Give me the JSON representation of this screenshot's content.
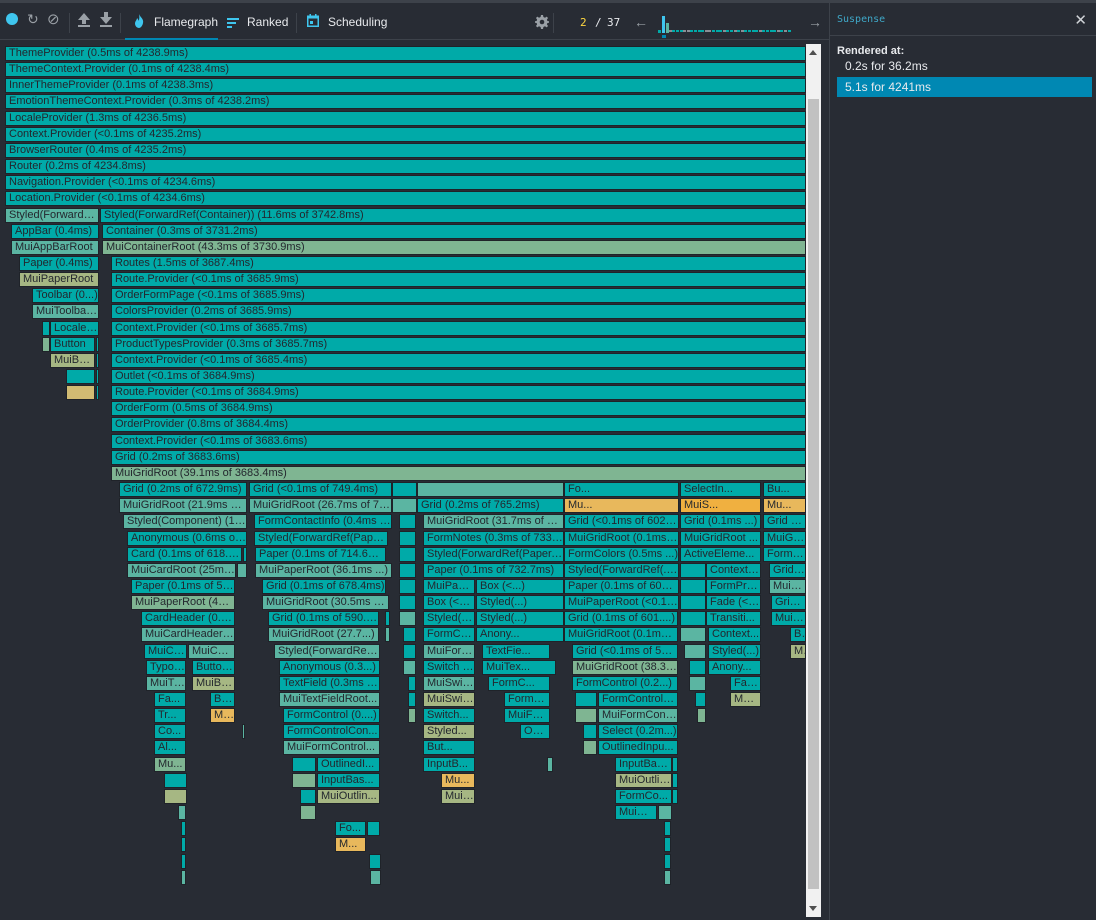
{
  "toolbar": {
    "buttons": [
      {
        "name": "record-button",
        "icon": "record-icon",
        "glyph": "●"
      },
      {
        "name": "reload-and-profile-button",
        "icon": "reload-icon",
        "glyph": "↻"
      },
      {
        "name": "clear-profile-button",
        "icon": "clear-icon",
        "glyph": "⊘"
      },
      {
        "name": "load-profile-button",
        "icon": "upload-icon",
        "glyph": "⇧"
      },
      {
        "name": "save-profile-button",
        "icon": "download-icon",
        "glyph": "⇩"
      }
    ],
    "tabs": [
      {
        "label": "Flamegraph",
        "icon": "flame-icon",
        "active": true
      },
      {
        "label": "Ranked",
        "icon": "ranked-icon",
        "active": false
      },
      {
        "label": "Scheduling",
        "icon": "calendar-icon",
        "active": false
      }
    ],
    "settings_icon": "gear-icon",
    "commit": {
      "current": "2",
      "separator": "/",
      "total": "37"
    },
    "prev_icon": "arrow-left-icon",
    "next_icon": "arrow-right-icon",
    "commit_durations_relative": [
      0.15,
      0.85,
      0.5,
      0.02,
      0.02,
      0.02,
      0.02,
      0.02,
      0.02,
      0.02,
      0.02,
      0.02,
      0.02,
      0.02,
      0.02,
      0.02,
      0.02,
      0.02,
      0.02,
      0.02,
      0.02,
      0.02,
      0.02,
      0.02,
      0.02,
      0.02,
      0.02,
      0.02,
      0.02,
      0.02,
      0.02,
      0.02,
      0.02,
      0.02,
      0.02,
      0.02,
      0.02
    ],
    "selected_commit_index": 1
  },
  "colors": {
    "teal": "#00aaa8",
    "teal_light": "#5bb5a2",
    "sage": "#7fb592",
    "olive": "#a6b783",
    "tan": "#d1bb73",
    "gold": "#e8b85c",
    "orange": "#f0b040",
    "accent": "#0088b3",
    "selected_bg": "#0088b3",
    "commit_yellow": "#ffd740"
  },
  "sidebar": {
    "title": "Suspense",
    "close_icon": "close-icon",
    "rendered_at_label": "Rendered at:",
    "renders": [
      {
        "label": "0.2s for 36.2ms",
        "selected": false
      },
      {
        "label": "5.1s for 4241ms",
        "selected": true
      }
    ]
  },
  "flamegraph": {
    "nodes": [
      {
        "label": "ThemeProvider (0.5ms of 4238.9ms)",
        "color": "teal"
      },
      {
        "label": "ThemeContext.Provider (0.1ms of 4238.4ms)",
        "color": "teal"
      },
      {
        "label": "InnerThemeProvider (0.1ms of 4238.3ms)",
        "color": "teal"
      },
      {
        "label": "EmotionThemeContext.Provider (0.3ms of 4238.2ms)",
        "color": "teal"
      },
      {
        "label": "LocaleProvider (1.3ms of 4236.5ms)",
        "color": "teal"
      },
      {
        "label": "Context.Provider (<0.1ms of 4235.2ms)",
        "color": "teal"
      },
      {
        "label": "BrowserRouter (0.4ms of 4235.2ms)",
        "color": "teal"
      },
      {
        "label": "Router (0.2ms of 4234.8ms)",
        "color": "teal"
      },
      {
        "label": "Navigation.Provider (<0.1ms of 4234.6ms)",
        "color": "teal"
      },
      {
        "label": "Location.Provider (<0.1ms of 4234.6ms)",
        "color": "teal"
      },
      {
        "label": "Styled(ForwardRef(AppBar))",
        "color": "teal_light"
      },
      {
        "label": "Styled(ForwardRef(Container)) (11.6ms of 3742.8ms)",
        "color": "teal"
      },
      {
        "label": "AppBar (0.4ms)",
        "color": "teal"
      },
      {
        "label": "Container (0.3ms of 3731.2ms)",
        "color": "teal"
      },
      {
        "label": "MuiAppBarRoot",
        "color": "teal_light"
      },
      {
        "label": "MuiContainerRoot (43.3ms of 3730.9ms)",
        "color": "sage"
      },
      {
        "label": "Paper (0.4ms)",
        "color": "teal"
      },
      {
        "label": "Routes (1.5ms of 3687.4ms)",
        "color": "teal"
      },
      {
        "label": "MuiPaperRoot",
        "color": "olive"
      },
      {
        "label": "Route.Provider (<0.1ms of 3685.9ms)",
        "color": "teal"
      },
      {
        "label": "Toolbar (0...)",
        "color": "teal"
      },
      {
        "label": "OrderFormPage (<0.1ms of 3685.9ms)",
        "color": "teal"
      },
      {
        "label": "MuiToolbarRoot",
        "color": "teal_light"
      },
      {
        "label": "ColorsProvider (0.2ms of 3685.9ms)",
        "color": "teal"
      },
      {
        "label": "",
        "color": "teal"
      },
      {
        "label": "LocalePicker",
        "color": "teal"
      },
      {
        "label": "Context.Provider (<0.1ms of 3685.7ms)",
        "color": "teal"
      },
      {
        "label": "",
        "color": "sage"
      },
      {
        "label": "Button",
        "color": "teal"
      },
      {
        "label": "",
        "color": "teal"
      },
      {
        "label": "ProductTypesProvider (0.3ms of 3685.7ms)",
        "color": "teal"
      },
      {
        "label": "MuiButtonBase",
        "color": "olive"
      },
      {
        "label": "",
        "color": "teal"
      },
      {
        "label": "Context.Provider (<0.1ms of 3685.4ms)",
        "color": "teal"
      },
      {
        "label": "",
        "color": "teal"
      },
      {
        "label": "",
        "color": "teal"
      },
      {
        "label": "Outlet (<0.1ms of 3684.9ms)",
        "color": "teal"
      },
      {
        "label": "",
        "color": "tan"
      },
      {
        "label": "",
        "color": "teal"
      },
      {
        "label": "Route.Provider (<0.1ms of 3684.9ms)",
        "color": "teal"
      },
      {
        "label": "OrderForm (0.5ms of 3684.9ms)",
        "color": "teal"
      },
      {
        "label": "OrderProvider (0.8ms of 3684.4ms)",
        "color": "teal"
      },
      {
        "label": "Context.Provider (<0.1ms of 3683.6ms)",
        "color": "teal"
      },
      {
        "label": "Grid (0.2ms of 3683.6ms)",
        "color": "teal"
      },
      {
        "label": "MuiGridRoot (39.1ms of 3683.4ms)",
        "color": "sage"
      },
      {
        "label": "Grid (0.2ms of 672.9ms)",
        "color": "teal"
      },
      {
        "label": "MuiGridRoot (21.9ms of 672.7ms)",
        "color": "teal_light"
      },
      {
        "label": "Styled(Component) (1...)",
        "color": "teal_light"
      },
      {
        "label": "Anonymous (0.6ms of ...)",
        "color": "teal"
      },
      {
        "label": "Card (0.1ms of 618....)",
        "color": "teal"
      },
      {
        "label": "",
        "color": "teal"
      },
      {
        "label": "MuiCardRoot (25ms ...)",
        "color": "teal_light"
      },
      {
        "label": "",
        "color": "teal_light"
      },
      {
        "label": "Paper (0.1ms of 59...)",
        "color": "teal"
      },
      {
        "label": "MuiPaperRoot (49....)",
        "color": "sage"
      },
      {
        "label": "CardHeader (0.6...)",
        "color": "teal"
      },
      {
        "label": "MuiCardHeaderRoot",
        "color": "teal_light"
      },
      {
        "label": "MuiCardHeaderAvatar",
        "color": "teal"
      },
      {
        "label": "MuiCardHeaderContent",
        "color": "teal_light"
      },
      {
        "label": "Typography",
        "color": "teal"
      },
      {
        "label": "Button ...",
        "color": "teal"
      },
      {
        "label": "MuiTypography",
        "color": "teal_light"
      },
      {
        "label": "MuiButton...",
        "color": "olive"
      },
      {
        "label": "Fa...",
        "color": "teal"
      },
      {
        "label": "But...",
        "color": "teal"
      },
      {
        "label": "Tr...",
        "color": "teal"
      },
      {
        "label": "Mui...",
        "color": "gold"
      },
      {
        "label": "Co...",
        "color": "teal"
      },
      {
        "label": "",
        "color": "teal_light"
      },
      {
        "label": "Al...",
        "color": "teal"
      },
      {
        "label": "Mu...",
        "color": "sage"
      },
      {
        "label": "",
        "color": "teal"
      },
      {
        "label": "",
        "color": "olive"
      },
      {
        "label": "",
        "color": "teal_light"
      },
      {
        "label": "",
        "color": "teal"
      },
      {
        "label": "",
        "color": "teal"
      },
      {
        "label": "",
        "color": "teal"
      },
      {
        "label": "",
        "color": "teal_light"
      },
      {
        "label": "Grid (<0.1ms of 749.4ms)",
        "color": "teal"
      },
      {
        "label": "MuiGridRoot (26.7ms of 7...)",
        "color": "teal_light"
      },
      {
        "label": "FormContactInfo (0.4ms ...)",
        "color": "teal"
      },
      {
        "label": "Styled(ForwardRef(Paper))",
        "color": "teal"
      },
      {
        "label": "Paper (0.1ms of 714.6ms)",
        "color": "teal"
      },
      {
        "label": "MuiPaperRoot (36.1ms ...)",
        "color": "teal_light"
      },
      {
        "label": "Grid (0.1ms of 678.4ms)",
        "color": "teal"
      },
      {
        "label": "MuiGridRoot (30.5ms o...)",
        "color": "teal_light"
      },
      {
        "label": "Grid (0.1ms of 590....)",
        "color": "teal"
      },
      {
        "label": "MuiGridRoot (27.7...)",
        "color": "teal_light"
      },
      {
        "label": "Styled(ForwardRef...)",
        "color": "teal_light"
      },
      {
        "label": "Anonymous (0.3...)",
        "color": "teal"
      },
      {
        "label": "TextField (0.3ms ...)",
        "color": "teal"
      },
      {
        "label": "MuiTextFieldRoot...",
        "color": "teal_light"
      },
      {
        "label": "FormControl (0....)",
        "color": "teal"
      },
      {
        "label": "FormControlCon...",
        "color": "teal"
      },
      {
        "label": "MuiFormControl...",
        "color": "teal_light"
      },
      {
        "label": "",
        "color": "teal"
      },
      {
        "label": "OutlinedI...",
        "color": "teal"
      },
      {
        "label": "",
        "color": "sage"
      },
      {
        "label": "InputBas...",
        "color": "teal"
      },
      {
        "label": "",
        "color": "teal"
      },
      {
        "label": "MuiOutlin...",
        "color": "olive"
      },
      {
        "label": "",
        "color": "sage"
      },
      {
        "label": "Fo...",
        "color": "teal"
      },
      {
        "label": "",
        "color": "teal"
      },
      {
        "label": "M...",
        "color": "gold"
      },
      {
        "label": "",
        "color": "teal"
      },
      {
        "label": "",
        "color": "teal_light"
      },
      {
        "label": "",
        "color": "teal_light"
      },
      {
        "label": "Grid (0.2ms of 765.2ms)",
        "color": "teal"
      },
      {
        "label": "MuiGridRoot (31.7ms of 76...)",
        "color": "teal_light"
      },
      {
        "label": "FormNotes (0.3ms of 733...)",
        "color": "teal"
      },
      {
        "label": "Styled(ForwardRef(Paper...))",
        "color": "teal"
      },
      {
        "label": "Paper (0.1ms of 732.7ms)",
        "color": "teal"
      },
      {
        "label": "MuiPaperRoot (0.1ms of ...)",
        "color": "teal"
      },
      {
        "label": "Box (<...)",
        "color": "teal"
      },
      {
        "label": "Box (<0.1ms o...)",
        "color": "teal"
      },
      {
        "label": "Styled(...)",
        "color": "teal"
      },
      {
        "label": "Styled(div) (<0...)",
        "color": "teal"
      },
      {
        "label": "Styled(...)",
        "color": "teal"
      },
      {
        "label": "FormControlL...",
        "color": "teal"
      },
      {
        "label": "Anony...",
        "color": "teal"
      },
      {
        "label": "MuiFormContr...",
        "color": "teal_light"
      },
      {
        "label": "TextFie...",
        "color": "teal"
      },
      {
        "label": "Switch (0.2...)",
        "color": "teal"
      },
      {
        "label": "MuiTex...",
        "color": "teal"
      },
      {
        "label": "MuiSwitchR...",
        "color": "teal_light"
      },
      {
        "label": "FormC...",
        "color": "teal"
      },
      {
        "label": "MuiSwitc...",
        "color": "olive"
      },
      {
        "label": "FormC...",
        "color": "teal"
      },
      {
        "label": "Switch...",
        "color": "teal"
      },
      {
        "label": "MuiFor...",
        "color": "teal"
      },
      {
        "label": "Styled...",
        "color": "olive"
      },
      {
        "label": "Outline...",
        "color": "teal"
      },
      {
        "label": "But...",
        "color": "teal"
      },
      {
        "label": "InputB...",
        "color": "teal"
      },
      {
        "label": "Mu...",
        "color": "gold"
      },
      {
        "label": "MuiOut...",
        "color": "olive"
      },
      {
        "label": "Fo...",
        "color": "teal"
      },
      {
        "label": "Mu...",
        "color": "gold"
      },
      {
        "label": "Grid (<0.1ms of 602...)",
        "color": "teal"
      },
      {
        "label": "MuiGridRoot (0.1ms...)",
        "color": "teal"
      },
      {
        "label": "FormColors (0.5ms ...)",
        "color": "teal"
      },
      {
        "label": "Styled(ForwardRef(...))",
        "color": "teal"
      },
      {
        "label": "Paper (0.1ms of 601...)",
        "color": "teal"
      },
      {
        "label": "MuiPaperRoot (<0.1...)",
        "color": "teal"
      },
      {
        "label": "Grid (0.1ms of 601....)",
        "color": "teal"
      },
      {
        "label": "MuiGridRoot (0.1ms...)",
        "color": "teal"
      },
      {
        "label": "Grid (<0.1ms of 589...)",
        "color": "teal"
      },
      {
        "label": "MuiGridRoot (38.3...)",
        "color": "sage"
      },
      {
        "label": "FormControl (0.2...)",
        "color": "teal"
      },
      {
        "label": "FormControlCont...",
        "color": "teal"
      },
      {
        "label": "MuiFormControlR...",
        "color": "teal_light"
      },
      {
        "label": "Select (0.2m...)",
        "color": "teal"
      },
      {
        "label": "OutlinedInpu...",
        "color": "teal"
      },
      {
        "label": "InputBase (0...)",
        "color": "teal"
      },
      {
        "label": "MuiOutlinedI...",
        "color": "olive"
      },
      {
        "label": "FormCo...",
        "color": "teal"
      },
      {
        "label": "MuiOutl...",
        "color": "teal"
      },
      {
        "label": "SelectIn...",
        "color": "teal"
      },
      {
        "label": "MuiS...",
        "color": "orange"
      },
      {
        "label": "Grid (0.1ms ...)",
        "color": "teal"
      },
      {
        "label": "MuiGridRoot ...",
        "color": "teal"
      },
      {
        "label": "ActiveEleme...",
        "color": "teal"
      },
      {
        "label": "Context.Prov...",
        "color": "teal"
      },
      {
        "label": "FormProduct...",
        "color": "teal"
      },
      {
        "label": "Fade (<...)",
        "color": "teal"
      },
      {
        "label": "Transiti...",
        "color": "teal"
      },
      {
        "label": "Context...",
        "color": "teal"
      },
      {
        "label": "Styled(...)",
        "color": "teal"
      },
      {
        "label": "Anony...",
        "color": "teal"
      },
      {
        "label": "Fab (0....)",
        "color": "teal"
      },
      {
        "label": "MuiFab...",
        "color": "olive"
      },
      {
        "label": "Bu...",
        "color": "teal"
      },
      {
        "label": "Mu...",
        "color": "gold"
      },
      {
        "label": "Grid (<0...)",
        "color": "teal"
      },
      {
        "label": "MuiGrid...",
        "color": "teal"
      },
      {
        "label": "FormSu...",
        "color": "teal"
      },
      {
        "label": "Grid (0...)",
        "color": "teal"
      },
      {
        "label": "MuiGrid...",
        "color": "teal_light"
      },
      {
        "label": "Grid (0...)",
        "color": "teal"
      },
      {
        "label": "MuiGri...",
        "color": "teal"
      },
      {
        "label": "Button...",
        "color": "teal"
      },
      {
        "label": "MuiBu...",
        "color": "olive"
      },
      {
        "label": "",
        "color": "teal"
      },
      {
        "label": "",
        "color": "tan"
      }
    ]
  }
}
